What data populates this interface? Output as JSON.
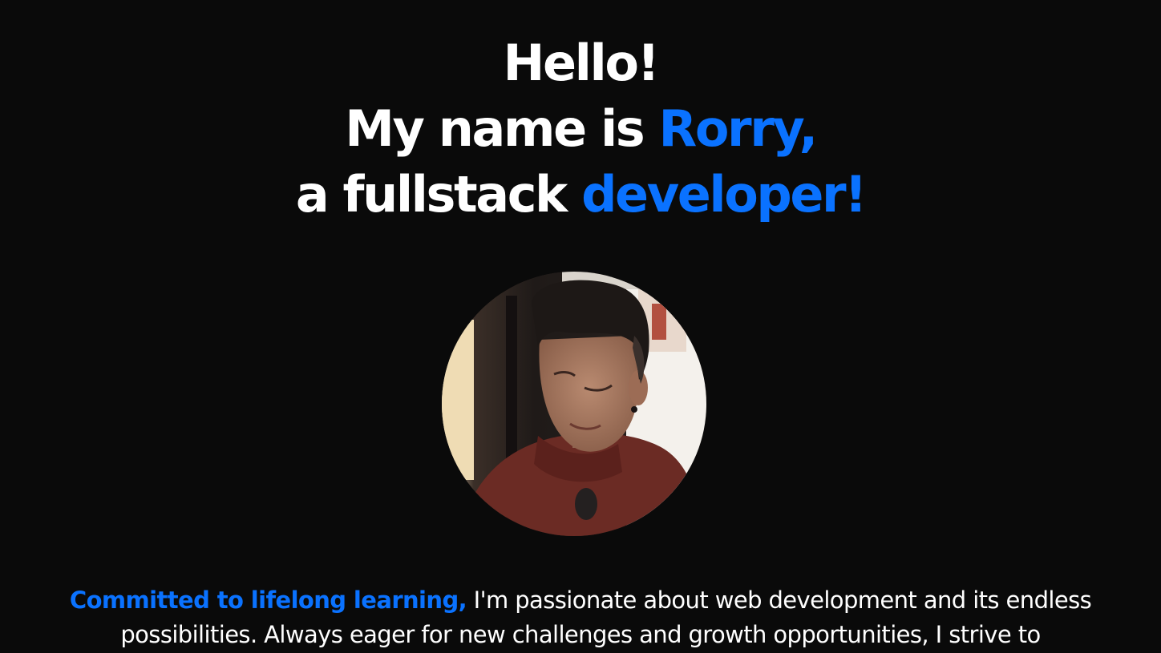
{
  "hero": {
    "greeting": "Hello!",
    "name_prefix": "My name is ",
    "name": "Rorry,",
    "role_prefix": "a fullstack ",
    "role": "developer!"
  },
  "profile": {
    "avatar_alt": "Rorry"
  },
  "intro": {
    "lead": "Committed to lifelong learning,",
    "body": " I'm passionate about web development and its endless possibilities. Always eager for new challenges and growth opportunities, I strive to"
  },
  "colors": {
    "background": "#0a0a0a",
    "text": "#ffffff",
    "accent": "#0a72ff"
  }
}
